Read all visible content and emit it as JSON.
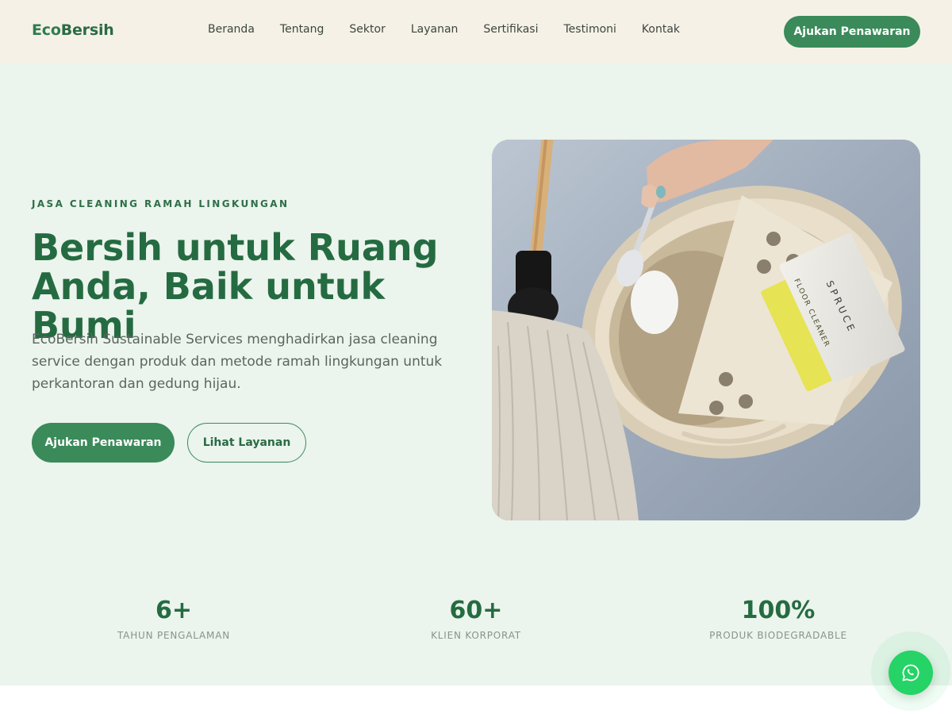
{
  "brand": {
    "logo_part1": "Eco",
    "logo_part2": "Bersih"
  },
  "nav": {
    "items": [
      "Beranda",
      "Tentang",
      "Sektor",
      "Layanan",
      "Sertifikasi",
      "Testimoni",
      "Kontak"
    ]
  },
  "header": {
    "cta_label": "Ajukan Penawaran"
  },
  "hero": {
    "eyebrow": "JASA CLEANING RAMAH LINGKUNGAN",
    "title": "Bersih untuk Ruang Anda, Baik untuk Bumi",
    "description": "EcoBersih Sustainable Services menghadirkan jasa cleaning service dengan produk dan metode ramah lingkungan untuk perkantoran dan gedung hijau.",
    "primary_cta": "Ajukan Penawaran",
    "secondary_cta": "Lihat Layanan",
    "photo": {
      "package_brand": "SPRUCE",
      "package_product": "FLOOR CLEANER"
    }
  },
  "stats": [
    {
      "value": "6+",
      "label": "TAHUN PENGALAMAN"
    },
    {
      "value": "60+",
      "label": "KLIEN KORPORAT"
    },
    {
      "value": "100%",
      "label": "PRODUK BIODEGRADABLE"
    }
  ],
  "floating": {
    "icon": "whatsapp-icon"
  },
  "colors": {
    "primary": "#3a8a5a",
    "header_bg": "#f6f1e6",
    "hero_bg": "#ebf4ed",
    "heading": "#256b41",
    "whatsapp": "#25d366"
  }
}
